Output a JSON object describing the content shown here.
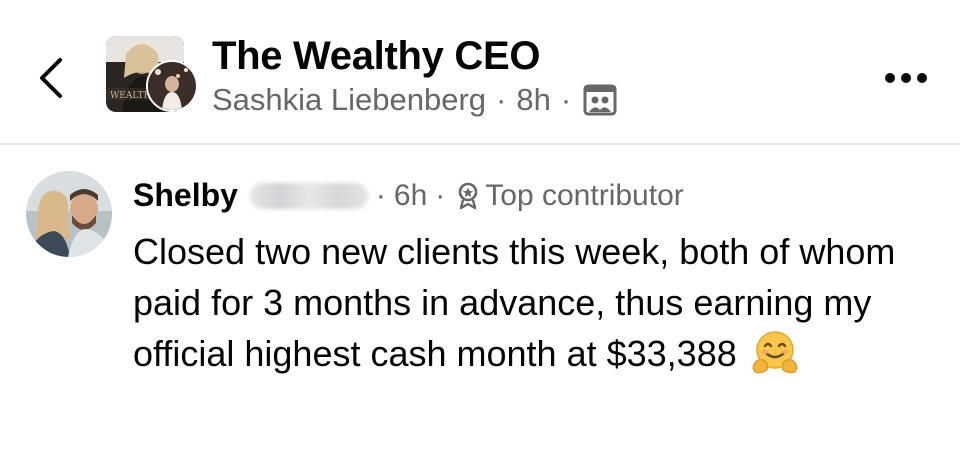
{
  "header": {
    "group_name": "The Wealthy CEO",
    "poster_name": "Sashkia Liebenberg",
    "separator": "·",
    "time": "8h",
    "audience_icon": "group-audience-icon",
    "more_icon": "more-horizontal-icon",
    "back_icon": "chevron-left-icon"
  },
  "comment": {
    "author": "Shelby",
    "separator": "·",
    "time": "6h",
    "badge_icon": "top-contributor-icon",
    "badge_label": "Top contributor",
    "body": "Closed two new clients this week, both of whom paid for 3 months in advance, thus earning my official highest cash month at $33,388",
    "emoji": "hugging-face-emoji"
  },
  "colors": {
    "primary_text": "#050505",
    "secondary_text": "#65676b",
    "divider": "#e4e6eb",
    "background": "#ffffff"
  }
}
